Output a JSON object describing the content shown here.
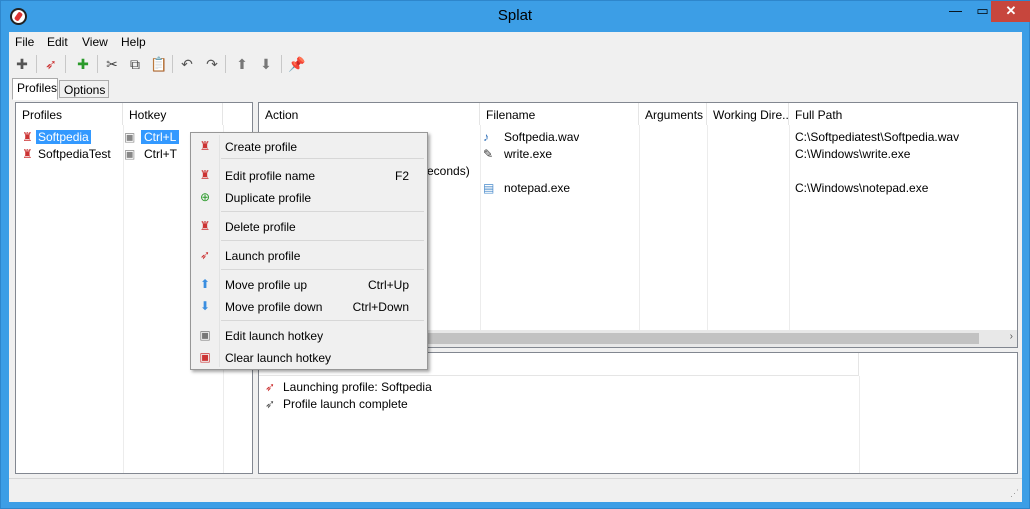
{
  "window": {
    "title": "Splat",
    "minimize": "—",
    "maximize": "▭",
    "close": "✕"
  },
  "menu": [
    "File",
    "Edit",
    "View",
    "Help"
  ],
  "toolbar": {
    "buttons": [
      {
        "name": "new-profile-icon",
        "glyph": "✚"
      },
      {
        "name": "launch-profile-icon",
        "glyph": "➶"
      },
      {
        "name": "add-action-icon",
        "glyph": "✚"
      },
      {
        "name": "cut-icon",
        "glyph": "✂"
      },
      {
        "name": "copy-icon",
        "glyph": "⧉"
      },
      {
        "name": "paste-icon",
        "glyph": "📋"
      },
      {
        "name": "undo-icon",
        "glyph": "↶"
      },
      {
        "name": "redo-icon",
        "glyph": "↷"
      },
      {
        "name": "move-up-icon",
        "glyph": "⬆"
      },
      {
        "name": "move-down-icon",
        "glyph": "⬇"
      },
      {
        "name": "pin-icon",
        "glyph": "📌"
      }
    ]
  },
  "tabs": {
    "profiles": "Profiles",
    "options": "Options"
  },
  "profiles_panel": {
    "headers": {
      "profiles": "Profiles",
      "hotkey": "Hotkey"
    },
    "rows": [
      {
        "name": "Softpedia",
        "hotkey": "Ctrl+L"
      },
      {
        "name": "SoftpediaTest",
        "hotkey": "Ctrl+T"
      }
    ]
  },
  "actions_panel": {
    "headers": {
      "action": "Action",
      "filename": "Filename",
      "arguments": "Arguments",
      "working_dir": "Working Dire...",
      "full_path": "Full Path"
    },
    "rows": [
      {
        "action": "",
        "filename": "Softpedia.wav",
        "arguments": "",
        "working_dir": "",
        "full_path": "C:\\Softpediatest\\Softpedia.wav"
      },
      {
        "action": "",
        "filename": "write.exe",
        "arguments": "",
        "working_dir": "",
        "full_path": "C:\\Windows\\write.exe"
      },
      {
        "action": "econds)",
        "filename": "",
        "arguments": "",
        "working_dir": "",
        "full_path": ""
      },
      {
        "action": "",
        "filename": "notepad.exe",
        "arguments": "",
        "working_dir": "",
        "full_path": "C:\\Windows\\notepad.exe"
      }
    ]
  },
  "log_panel": {
    "rows": [
      {
        "text": "Launching profile: Softpedia"
      },
      {
        "text": "Profile launch complete"
      }
    ]
  },
  "context_menu": {
    "items": [
      {
        "label": "Create profile",
        "shortcut": ""
      },
      {
        "label": "Edit profile name",
        "shortcut": "F2"
      },
      {
        "label": "Duplicate profile",
        "shortcut": ""
      },
      {
        "label": "Delete profile",
        "shortcut": ""
      },
      {
        "label": "Launch profile",
        "shortcut": ""
      },
      {
        "label": "Move profile up",
        "shortcut": "Ctrl+Up"
      },
      {
        "label": "Move profile down",
        "shortcut": "Ctrl+Down"
      },
      {
        "label": "Edit launch hotkey",
        "shortcut": ""
      },
      {
        "label": "Clear launch hotkey",
        "shortcut": ""
      }
    ]
  },
  "colors": {
    "titlebar": "#3c9ee6",
    "selection": "#3399ff",
    "close": "#c7463d"
  }
}
